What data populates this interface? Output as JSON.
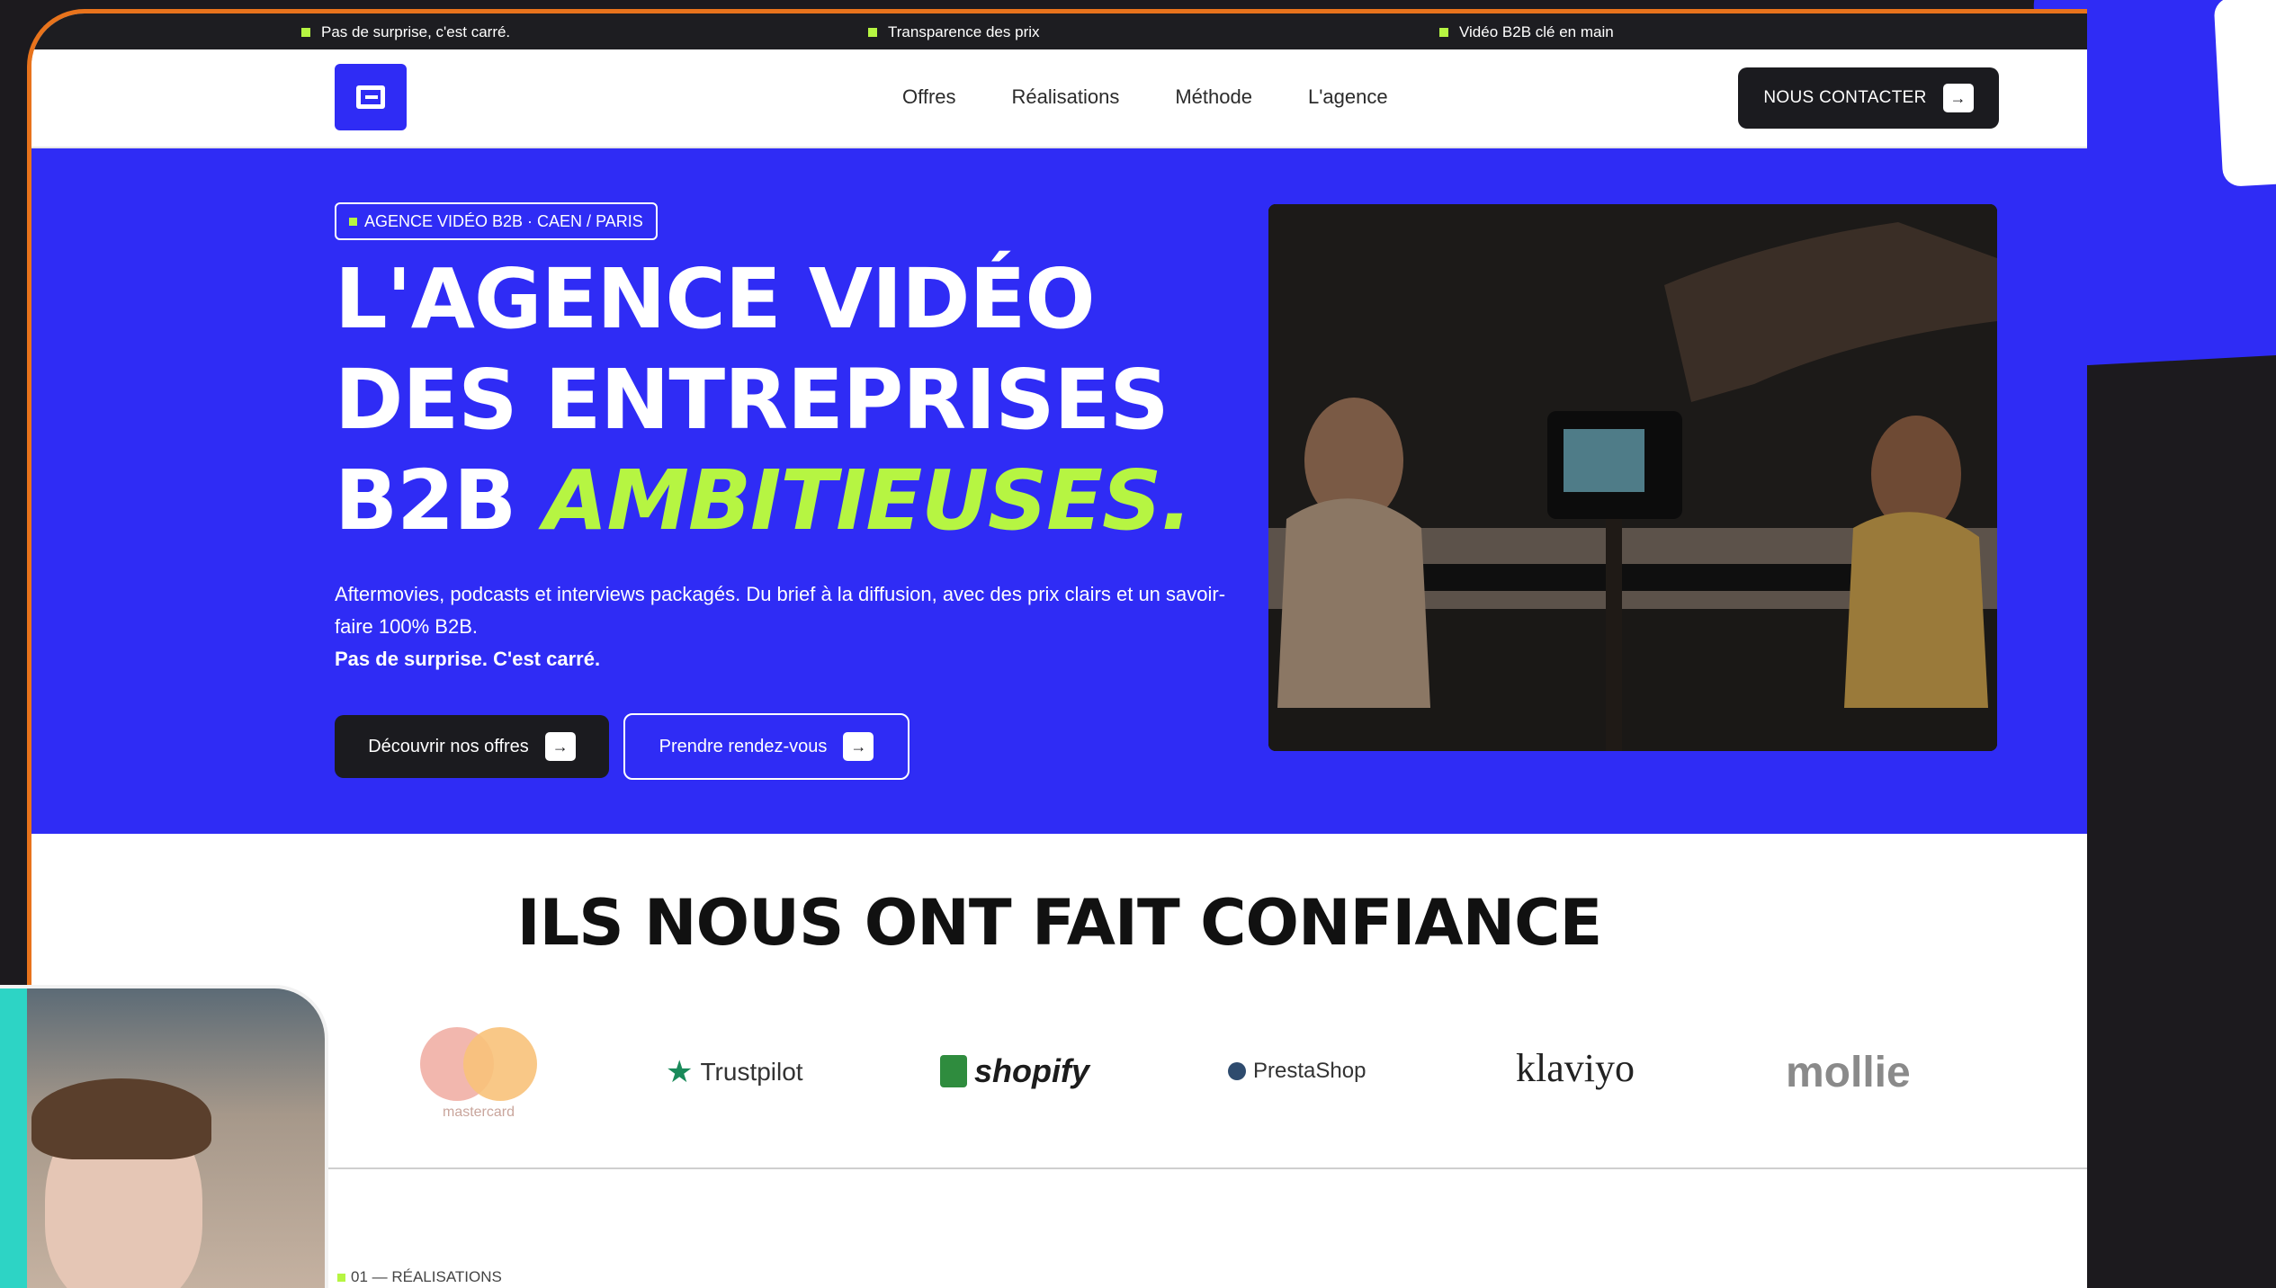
{
  "ticker": {
    "items": [
      "Pas de surprise, c'est carré.",
      "Transparence des prix",
      "Vidéo B2B clé en main"
    ]
  },
  "nav": {
    "menu": [
      "Offres",
      "Réalisations",
      "Méthode",
      "L'agence"
    ],
    "cta_label": "NOUS CONTACTER",
    "arrow": "→"
  },
  "hero": {
    "tag": "AGENCE VIDÉO B2B · CAEN / PARIS",
    "title_line1": "L'AGENCE VIDÉO",
    "title_line2": "DES ENTREPRISES",
    "title_line3_plain": "B2B ",
    "title_line3_accent": "AMBITIEUSES.",
    "description": "Aftermovies, podcasts et interviews packagés. Du brief à la diffusion, avec des prix clairs et un savoir-faire 100% B2B.",
    "description_bold": "Pas de surprise. C'est carré.",
    "btn_primary": "Découvrir nos offres",
    "btn_secondary": "Prendre rendez-vous"
  },
  "trust": {
    "title": "ILS NOUS ONT FAIT CONFIANCE",
    "logos": [
      "mastercard",
      "Trustpilot",
      "shopify",
      "PrestaShop",
      "klaviyo",
      "mollie"
    ]
  },
  "section": {
    "label": "01 — RÉALISATIONS"
  },
  "colors": {
    "brand_blue": "#2f2cf5",
    "accent_green": "#b6f542",
    "dark": "#1b1b1f",
    "frame_orange": "#e8731c"
  }
}
